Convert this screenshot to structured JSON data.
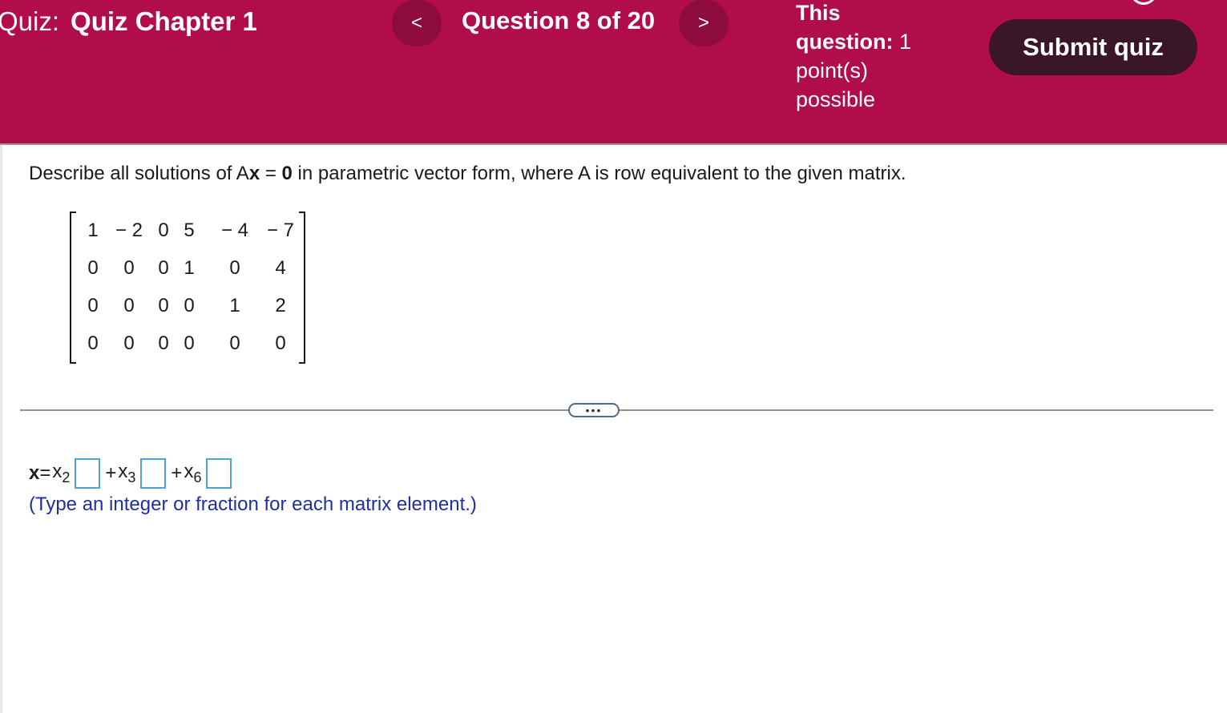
{
  "header": {
    "quiz_prefix": "Quiz:",
    "quiz_name": "Quiz Chapter 1",
    "prev_label": "<",
    "next_label": ">",
    "question_counter": "Question 8 of 20",
    "points_clipped": "possible",
    "points_this": "This",
    "points_question": "question:",
    "points_value": "1",
    "points_unit": "point(s)",
    "points_possible": "possible",
    "submit_label": "Submit quiz",
    "top_icon": "partial-icon"
  },
  "question": {
    "prompt_before": "Describe all solutions of A",
    "prompt_x": "x",
    "prompt_eq": " = ",
    "prompt_zero": "0",
    "prompt_after": " in parametric vector form, where A is row equivalent to the given matrix.",
    "matrix": [
      [
        "1",
        "− 2",
        "0",
        "5",
        "− 4",
        "− 7"
      ],
      [
        "0",
        "0",
        "0",
        "1",
        "0",
        "4"
      ],
      [
        "0",
        "0",
        "0",
        "0",
        "1",
        "2"
      ],
      [
        "0",
        "0",
        "0",
        "0",
        "0",
        "0"
      ]
    ]
  },
  "divider": {
    "more_label": "•••"
  },
  "answer": {
    "x_bold": "x",
    "eq": " = ",
    "terms": [
      {
        "prefix": "",
        "var": "x",
        "sub": "2",
        "value": ""
      },
      {
        "prefix": "+ ",
        "var": "x",
        "sub": "3",
        "value": ""
      },
      {
        "prefix": "+ ",
        "var": "x",
        "sub": "6",
        "value": ""
      }
    ],
    "hint": "(Type an integer or fraction for each matrix element.)"
  }
}
